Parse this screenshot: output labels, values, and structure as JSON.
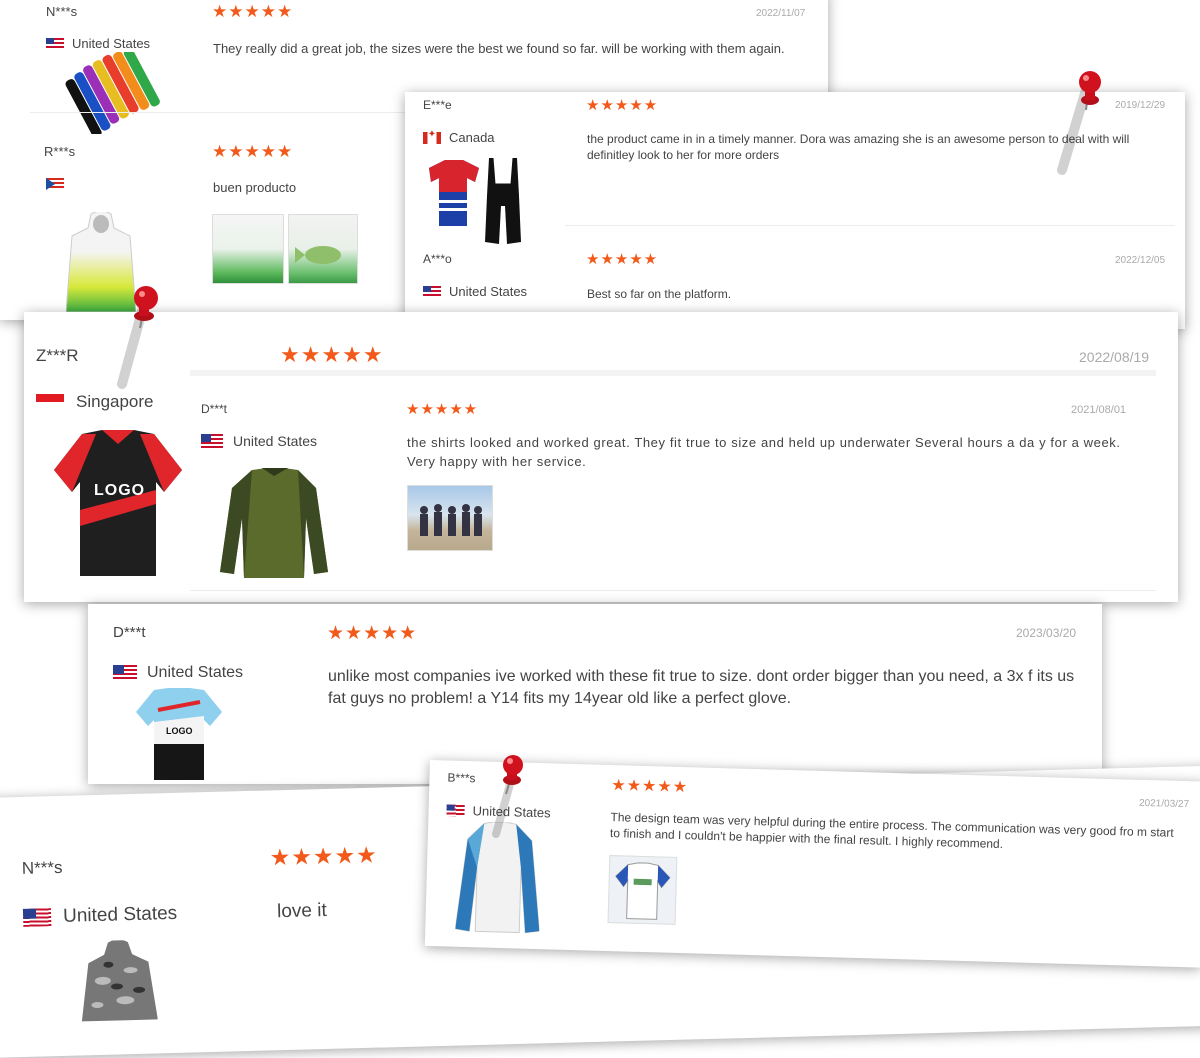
{
  "reviews": {
    "r1": {
      "name": "N***s",
      "country": "United States",
      "date": "2022/11/07",
      "stars": "★★★★★",
      "text": "They really did a great job, the sizes were the best we found so far. will be working with them again."
    },
    "r2": {
      "name": "R***s",
      "country": "",
      "stars": "★★★★★",
      "text": "buen producto"
    },
    "r3": {
      "name": "E***e",
      "country": "Canada",
      "date": "2019/12/29",
      "stars": "★★★★★",
      "text": "the product came in in a timely manner. Dora was amazing she is an awesome person to deal with will definitley look to her for more orders"
    },
    "r4": {
      "name": "A***o",
      "country": "United States",
      "date": "2022/12/05",
      "stars": "★★★★★",
      "text": "Best so far on the platform."
    },
    "r5": {
      "name": "Z***R",
      "country": "Singapore",
      "date": "2022/08/19",
      "stars": "★★★★★",
      "jersey_logo": "LOGO"
    },
    "r6": {
      "name": "D***t",
      "country": "United States",
      "date": "2021/08/01",
      "stars": "★★★★★",
      "text": "the shirts looked and worked great. They fit true to size and held up underwater Several hours a da y for a week. Very happy with her service."
    },
    "r7": {
      "name": "D***t",
      "country": "United States",
      "date": "2023/03/20",
      "stars": "★★★★★",
      "text": "unlike most companies ive worked with these fit true to size. dont order bigger than you need, a 3x f its us fat guys no problem! a Y14 fits my 14year old like a perfect glove.",
      "jersey_logo": "LOGO"
    },
    "r8": {
      "name": "B***s",
      "country": "United States",
      "date": "2021/03/27",
      "stars": "★★★★★",
      "text": "The design team was very helpful during the entire process. The communication was very good fro m start to finish and I couldn't be happier with the final result. I highly recommend."
    },
    "r9": {
      "name": "N***s",
      "country": "United States",
      "stars": "★★★★★",
      "text": "love it"
    }
  },
  "colors": {
    "star": "#f25a1b",
    "pin": "#d0121f",
    "date": "#aaaaaa"
  }
}
